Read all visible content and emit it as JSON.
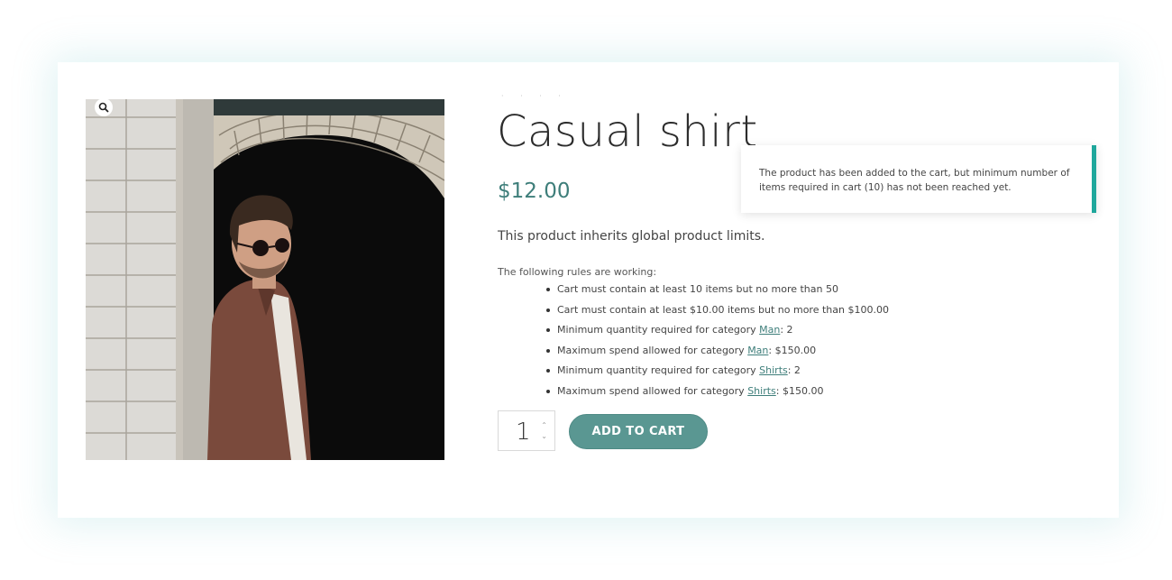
{
  "product": {
    "title": "Casual shirt",
    "price": "$12.00",
    "description": "This product inherits global product limits.",
    "image_alt": "Man in sunglasses wearing brown shirt leaning against brick archway"
  },
  "rules": {
    "intro": "The following rules are working:",
    "items": [
      {
        "prefix": "Cart must contain at least 10 items but no more than 50",
        "link": "",
        "suffix": ""
      },
      {
        "prefix": "Cart must contain at least $10.00 items but no more than $100.00",
        "link": "",
        "suffix": ""
      },
      {
        "prefix": "Minimum quantity required for category ",
        "link": "Man",
        "suffix": ": 2"
      },
      {
        "prefix": "Maximum spend allowed for category ",
        "link": "Man",
        "suffix": ": $150.00"
      },
      {
        "prefix": "Minimum quantity required for category ",
        "link": "Shirts",
        "suffix": ": 2"
      },
      {
        "prefix": "Maximum spend allowed for category ",
        "link": "Shirts",
        "suffix": ": $150.00"
      }
    ]
  },
  "cart": {
    "quantity": "1",
    "add_label": "ADD TO CART"
  },
  "notice": {
    "text": "The product has been added to the cart, but minimum number of items required in cart (10) has not been reached yet."
  },
  "icons": {
    "zoom": "magnifier-icon",
    "qty_up": "chevron-up-icon",
    "qty_down": "chevron-down-icon"
  },
  "colors": {
    "accent": "#3e7e7a",
    "button": "#5a9792",
    "notice_border": "#1fa79c"
  }
}
